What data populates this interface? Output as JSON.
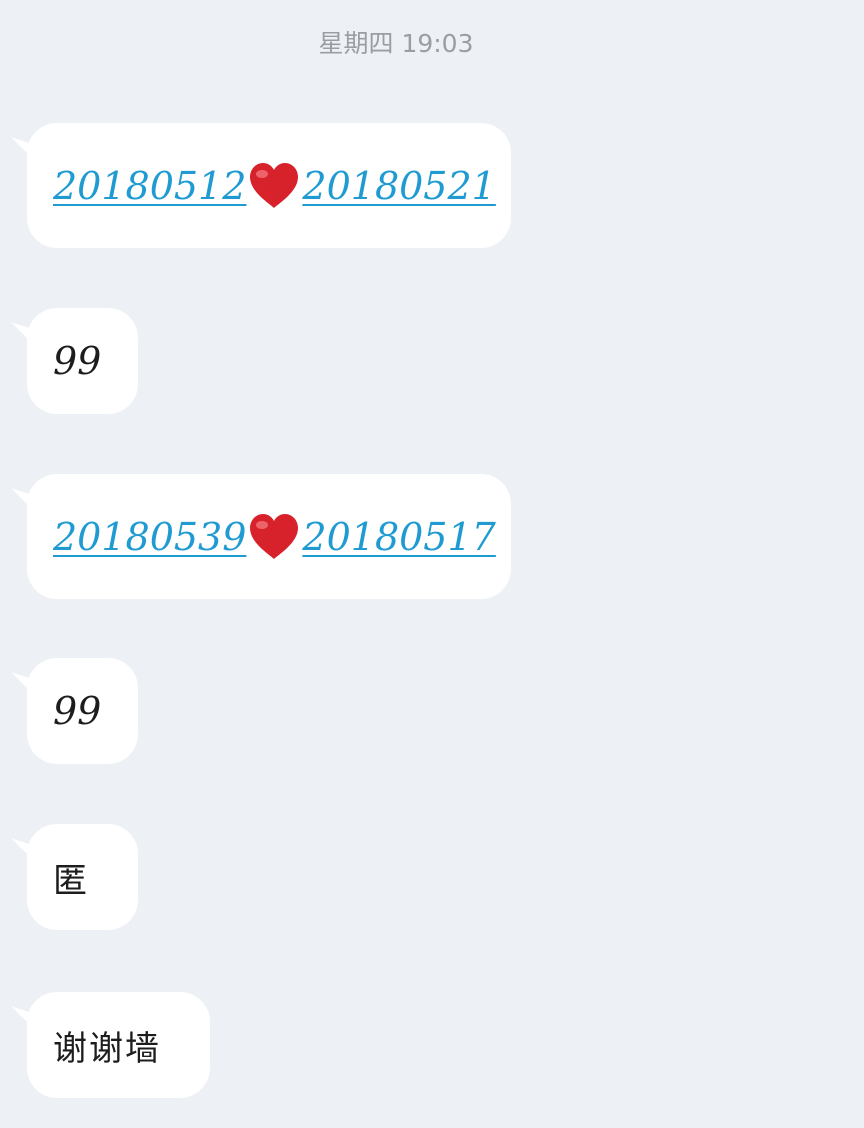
{
  "timestamp": "星期四 19:03",
  "messages": [
    {
      "type": "link-pair",
      "left": "20180512",
      "right": "20180521",
      "icon": "red-heart-icon"
    },
    {
      "type": "text",
      "text": "99"
    },
    {
      "type": "link-pair",
      "left": "20180539",
      "right": "20180517",
      "icon": "red-heart-icon"
    },
    {
      "type": "text",
      "text": "99"
    },
    {
      "type": "text",
      "text": "匿"
    },
    {
      "type": "text",
      "text": "谢谢墙"
    }
  ],
  "colors": {
    "background": "#edf0f4",
    "bubble": "#ffffff",
    "link": "#1f9bd2",
    "heart": "#d8222b",
    "timestamp": "#9a9ea4"
  }
}
